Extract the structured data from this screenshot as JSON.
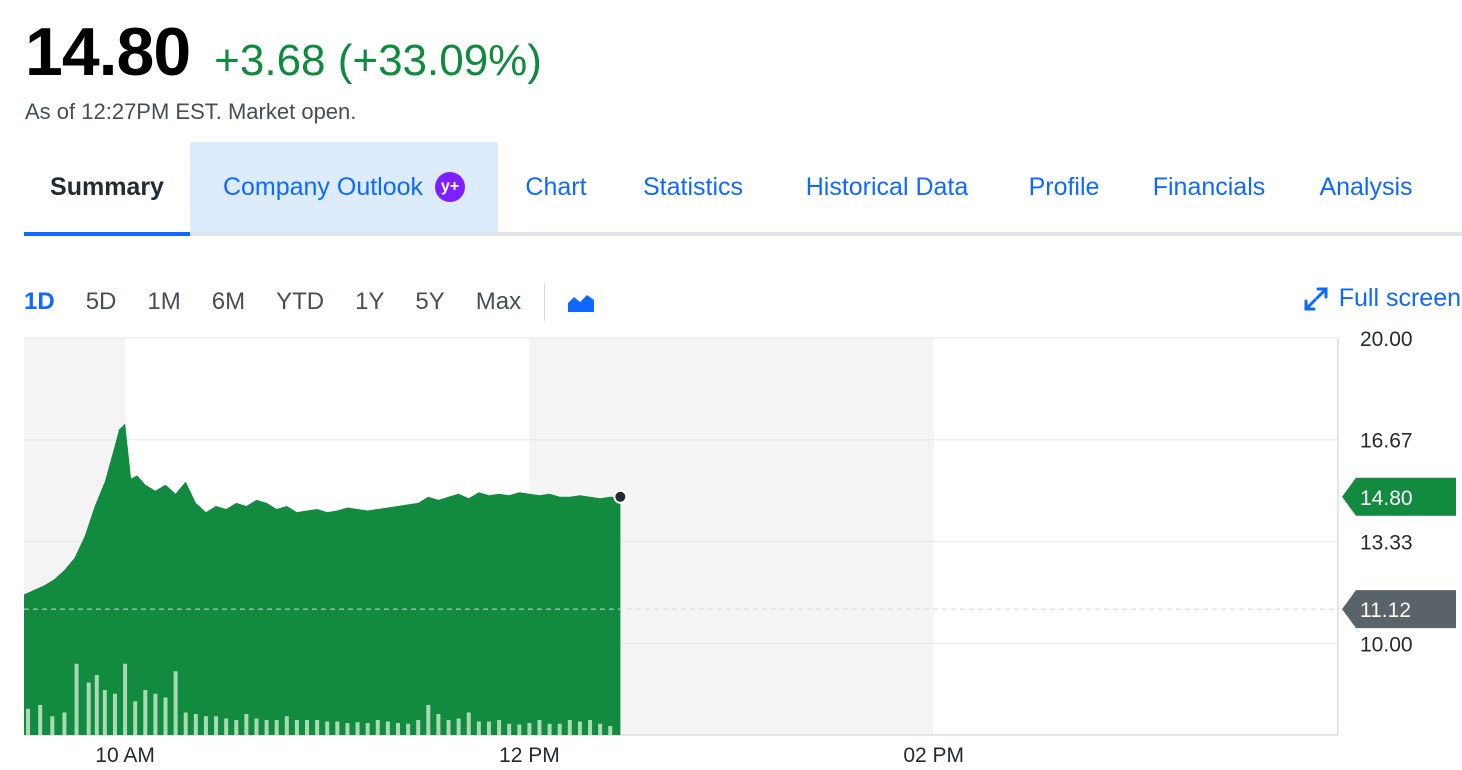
{
  "quote": {
    "price": "14.80",
    "change": "+3.68 (+33.09%)",
    "as_of": "As of 12:27PM EST. Market open."
  },
  "tabs": [
    {
      "label": "Summary",
      "active": true
    },
    {
      "label": "Company Outlook",
      "badge": "y+"
    },
    {
      "label": "Chart"
    },
    {
      "label": "Statistics"
    },
    {
      "label": "Historical Data"
    },
    {
      "label": "Profile"
    },
    {
      "label": "Financials"
    },
    {
      "label": "Analysis"
    }
  ],
  "ranges": [
    "1D",
    "5D",
    "1M",
    "6M",
    "YTD",
    "1Y",
    "5Y",
    "Max"
  ],
  "active_range": "1D",
  "chart_type_icon": "area-chart-icon",
  "fullscreen_label": "Full screen",
  "fullscreen_icon": "expand-arrows-icon",
  "colors": {
    "accent": "#0f69ff",
    "positive": "#108a3c",
    "area": "#128a40",
    "volume": "#a8dbb3",
    "prev_close_tag": "#5b636a",
    "premium": "#7e1fff"
  },
  "chart_data": {
    "type": "area",
    "y_ticks": [
      "20.00",
      "16.67",
      "13.33",
      "10.00"
    ],
    "ylim": [
      7.0,
      20.0
    ],
    "x_ticks": [
      {
        "t": 10.0,
        "label": "10 AM"
      },
      {
        "t": 12.0,
        "label": "12 PM"
      },
      {
        "t": 14.0,
        "label": "02 PM"
      }
    ],
    "xlim": [
      9.5,
      16.0
    ],
    "shaded_hours": [
      [
        9.5,
        10.0
      ],
      [
        12.0,
        14.0
      ]
    ],
    "current_price": {
      "value": 14.8,
      "label": "14.80"
    },
    "previous_close": {
      "value": 11.12,
      "label": "11.12"
    },
    "series": [
      {
        "x": [
          9.5,
          9.55,
          9.6,
          9.65,
          9.7,
          9.75,
          9.8,
          9.85,
          9.9,
          9.95,
          9.97,
          10.0,
          10.03,
          10.06,
          10.1,
          10.15,
          10.2,
          10.25,
          10.3,
          10.35,
          10.4,
          10.45,
          10.5,
          10.55,
          10.6,
          10.65,
          10.7,
          10.75,
          10.8,
          10.85,
          10.9,
          10.95,
          11.0,
          11.05,
          11.1,
          11.15,
          11.2,
          11.25,
          11.3,
          11.35,
          11.4,
          11.45,
          11.5,
          11.55,
          11.6,
          11.65,
          11.7,
          11.75,
          11.8,
          11.85,
          11.9,
          11.95,
          12.0,
          12.05,
          12.1,
          12.15,
          12.2,
          12.25,
          12.3,
          12.35,
          12.4,
          12.45
        ],
        "values": [
          11.6,
          11.75,
          11.9,
          12.1,
          12.4,
          12.8,
          13.5,
          14.5,
          15.3,
          16.5,
          17.0,
          17.2,
          15.4,
          15.5,
          15.2,
          15.0,
          15.2,
          14.9,
          15.3,
          14.6,
          14.3,
          14.5,
          14.4,
          14.6,
          14.5,
          14.7,
          14.6,
          14.4,
          14.5,
          14.3,
          14.35,
          14.4,
          14.3,
          14.35,
          14.45,
          14.4,
          14.35,
          14.4,
          14.45,
          14.5,
          14.55,
          14.6,
          14.8,
          14.7,
          14.8,
          14.9,
          14.75,
          14.95,
          14.85,
          14.9,
          14.85,
          14.95,
          14.9,
          14.85,
          14.9,
          14.8,
          14.8,
          14.85,
          14.8,
          14.75,
          14.8,
          14.8
        ]
      }
    ],
    "volume": {
      "x": [
        9.52,
        9.58,
        9.64,
        9.7,
        9.76,
        9.82,
        9.86,
        9.9,
        9.95,
        10.0,
        10.05,
        10.1,
        10.15,
        10.2,
        10.25,
        10.3,
        10.35,
        10.4,
        10.45,
        10.5,
        10.55,
        10.6,
        10.65,
        10.7,
        10.75,
        10.8,
        10.85,
        10.9,
        10.95,
        11.0,
        11.05,
        11.1,
        11.15,
        11.2,
        11.25,
        11.3,
        11.35,
        11.4,
        11.45,
        11.5,
        11.55,
        11.6,
        11.65,
        11.7,
        11.75,
        11.8,
        11.85,
        11.9,
        11.95,
        12.0,
        12.05,
        12.1,
        12.15,
        12.2,
        12.25,
        12.3,
        12.35,
        12.4
      ],
      "values": [
        0.35,
        0.4,
        0.25,
        0.3,
        0.95,
        0.7,
        0.8,
        0.6,
        0.55,
        0.95,
        0.45,
        0.6,
        0.55,
        0.5,
        0.85,
        0.3,
        0.28,
        0.25,
        0.25,
        0.22,
        0.2,
        0.28,
        0.22,
        0.2,
        0.2,
        0.25,
        0.2,
        0.2,
        0.2,
        0.18,
        0.18,
        0.16,
        0.17,
        0.16,
        0.2,
        0.18,
        0.16,
        0.15,
        0.2,
        0.4,
        0.28,
        0.2,
        0.22,
        0.3,
        0.18,
        0.18,
        0.2,
        0.15,
        0.14,
        0.16,
        0.2,
        0.15,
        0.15,
        0.2,
        0.18,
        0.2,
        0.15,
        0.12
      ]
    }
  }
}
